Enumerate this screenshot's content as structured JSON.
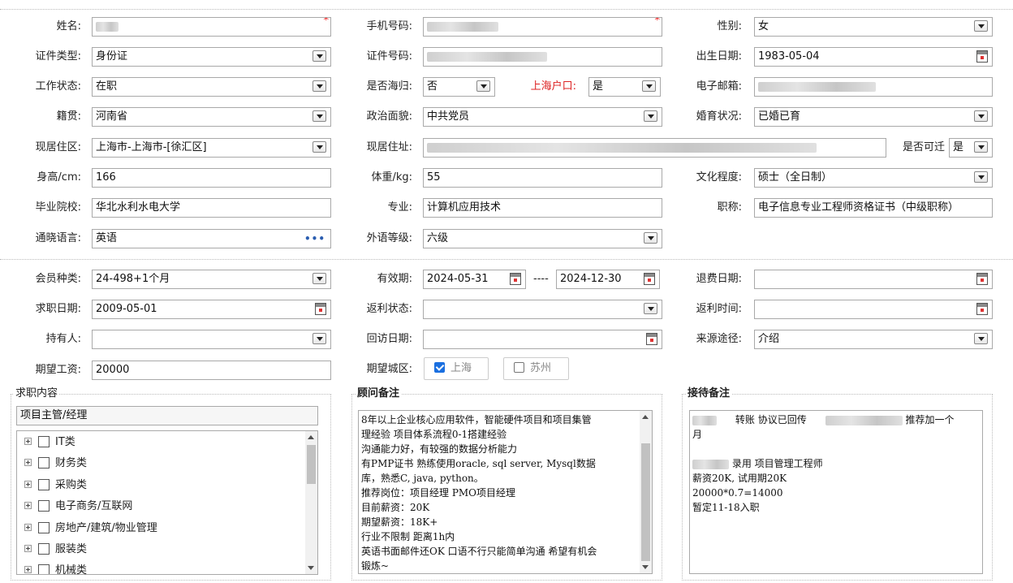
{
  "basic": {
    "name_label": "姓名:",
    "phone_label": "手机号码:",
    "gender_label": "性别:",
    "gender_value": "女",
    "id_type_label": "证件类型:",
    "id_type_value": "身份证",
    "id_number_label": "证件号码:",
    "birth_label": "出生日期:",
    "birth_value": "1983-05-04",
    "work_status_label": "工作状态:",
    "work_status_value": "在职",
    "returnee_label": "是否海归:",
    "returnee_value": "否",
    "shanghai_hukou_label": "上海户口:",
    "shanghai_hukou_value": "是",
    "email_label": "电子邮箱:",
    "native_label": "籍贯:",
    "native_value": "河南省",
    "political_label": "政治面貌:",
    "political_value": "中共党员",
    "marital_label": "婚育状况:",
    "marital_value": "已婚已育",
    "residence_area_label": "现居住区:",
    "residence_area_value": "上海市-上海市-[徐汇区]",
    "residence_addr_label": "现居住址:",
    "relocate_label": "是否可迁",
    "relocate_value": "是",
    "height_label": "身高/cm:",
    "height_value": "166",
    "weight_label": "体重/kg:",
    "weight_value": "55",
    "education_label": "文化程度:",
    "education_value": "硕士（全日制）",
    "school_label": "毕业院校:",
    "school_value": "华北水利水电大学",
    "major_label": "专业:",
    "major_value": "计算机应用技术",
    "title_label": "职称:",
    "title_value": "电子信息专业工程师资格证书（中级职称）",
    "language_label": "通晓语言:",
    "language_value": "英语",
    "language_more": "•••",
    "fl_level_label": "外语等级:",
    "fl_level_value": "六级"
  },
  "member": {
    "type_label": "会员种类:",
    "type_value": "24-498+1个月",
    "valid_label": "有效期:",
    "valid_from": "2024-05-31",
    "valid_sep": "----",
    "valid_to": "2024-12-30",
    "refund_date_label": "退费日期:",
    "job_date_label": "求职日期:",
    "job_date_value": "2009-05-01",
    "rebate_status_label": "返利状态:",
    "rebate_time_label": "返利时间:",
    "holder_label": "持有人:",
    "visit_date_label": "回访日期:",
    "source_label": "来源途径:",
    "source_value": "介绍",
    "salary_label": "期望工资:",
    "salary_value": "20000",
    "city_label": "期望城区:",
    "city_options": [
      {
        "label": "上海",
        "checked": true
      },
      {
        "label": "苏州",
        "checked": false
      }
    ]
  },
  "job_content": {
    "legend": "求职内容",
    "selected": "项目主管/经理",
    "tree": [
      "IT类",
      "财务类",
      "采购类",
      "电子商务/互联网",
      "房地产/建筑/物业管理",
      "服装类",
      "机械类"
    ]
  },
  "advisor_notes": {
    "legend": "顾问备注",
    "lines": [
      "8年以上企业核心应用软件，智能硬件项目和项目集管",
      "理经验  项目体系流程0-1搭建经验",
      "沟通能力好，有较强的数据分析能力",
      "有PMP证书 熟练使用oracle, sql server, Mysql数据",
      "库，熟悉C, java, python。",
      "推荐岗位：项目经理 PMO项目经理",
      "目前薪资：20K",
      "期望薪资：18K+",
      "行业不限制 距离1h内",
      "英语书面邮件还OK 口语不行只能简单沟通 希望有机会",
      "锻炼~"
    ]
  },
  "reception_notes": {
    "legend": "接待备注",
    "line1_a": "转账  协议已回传",
    "line1_b": "推荐加一个",
    "line2": "月",
    "line3": "录用 项目管理工程师",
    "line4": "薪资20K, 试用期20K",
    "line5": "20000*0.7=14000",
    "line6": "暂定11-18入职"
  }
}
